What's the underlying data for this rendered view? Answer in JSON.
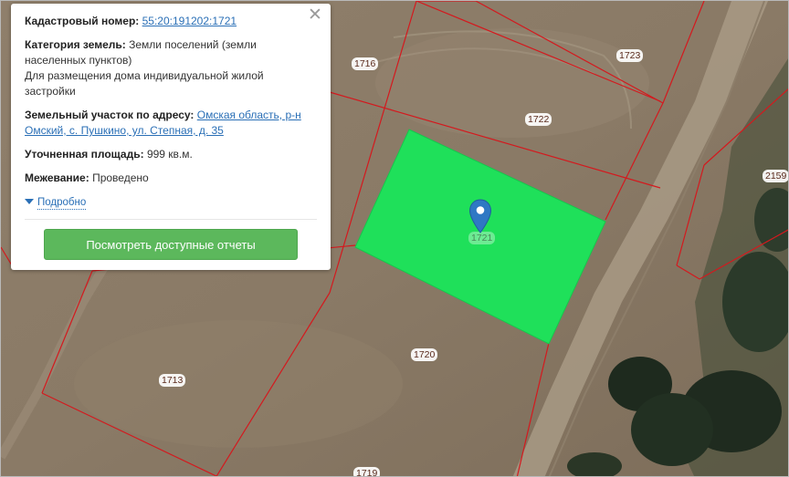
{
  "popup": {
    "cadastral_label": "Кадастровый номер:",
    "cadastral_number": "55:20:191202:1721",
    "category_label": "Категория земель:",
    "category_value": "Земли поселений (земли населенных пунктов)",
    "usage_value": "Для размещения дома индивидуальной жилой застройки",
    "address_label": "Земельный участок по адресу:",
    "address_value": "Омская область, р-н Омский, с. Пушкино, ул. Степная, д. 35",
    "area_label": "Уточненная площадь:",
    "area_value": "999 кв.м.",
    "survey_label": "Межевание:",
    "survey_value": "Проведено",
    "more_link": "Подробно",
    "reports_button": "Посмотреть доступные отчеты",
    "close_icon": "close-icon"
  },
  "map": {
    "selected_fill_color": "#1fe05a",
    "boundary_color": "#d4191e",
    "marker_color": "#2f78c4",
    "marker_icon": "map-pin-icon",
    "selected_parcel_label": "1721",
    "parcel_labels": [
      "1716",
      "1723",
      "1722",
      "2159",
      "1720",
      "1713",
      "1719"
    ]
  }
}
